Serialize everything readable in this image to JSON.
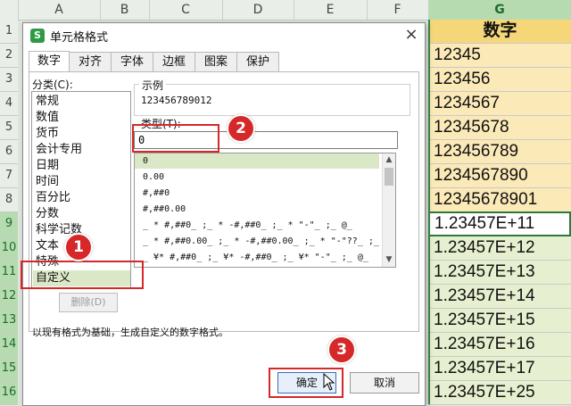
{
  "sheet": {
    "columns": [
      "A",
      "B",
      "C",
      "D",
      "E",
      "F",
      "G"
    ],
    "rows": [
      "1",
      "2",
      "3",
      "4",
      "5",
      "6",
      "7",
      "8",
      "9",
      "10",
      "11",
      "12",
      "13",
      "14",
      "15",
      "16"
    ],
    "g_header": "数字",
    "g_values": [
      "12345",
      "123456",
      "1234567",
      "12345678",
      "123456789",
      "1234567890",
      "12345678901",
      "1.23457E+11",
      "1.23457E+12",
      "1.23457E+13",
      "1.23457E+14",
      "1.23457E+15",
      "1.23457E+16",
      "1.23457E+17",
      "1.23457E+25"
    ]
  },
  "dialog": {
    "title": "单元格格式",
    "app_icon_letter": "S",
    "close": "×",
    "tabs": [
      "数字",
      "对齐",
      "字体",
      "边框",
      "图案",
      "保护"
    ],
    "category_label": "分类(C):",
    "categories": [
      "常规",
      "数值",
      "货币",
      "会计专用",
      "日期",
      "时间",
      "百分比",
      "分数",
      "科学记数",
      "文本",
      "特殊",
      "自定义"
    ],
    "sample_label": "示例",
    "sample_value": "123456789012",
    "type_label": "类型(T):",
    "type_value": "0",
    "formats": [
      "0",
      "0.00",
      "#,##0",
      "#,##0.00",
      "_ * #,##0_ ;_ * -#,##0_ ;_ * \"-\"_ ;_ @_",
      "_ * #,##0.00_ ;_ * -#,##0.00_ ;_ * \"-\"??_ ;_ @_",
      "_ ¥* #,##0_ ;_ ¥* -#,##0_ ;_ ¥* \"-\"_ ;_ @_"
    ],
    "delete_button": "删除(D)",
    "description": "以现有格式为基础，生成自定义的数字格式。",
    "ok_button": "确定",
    "cancel_button": "取消"
  },
  "annotations": [
    "1",
    "2",
    "3"
  ],
  "colors": {
    "highlight_red": "#d62828",
    "header_yellow": "#f5d77a",
    "accent_green": "#2e9a46"
  }
}
